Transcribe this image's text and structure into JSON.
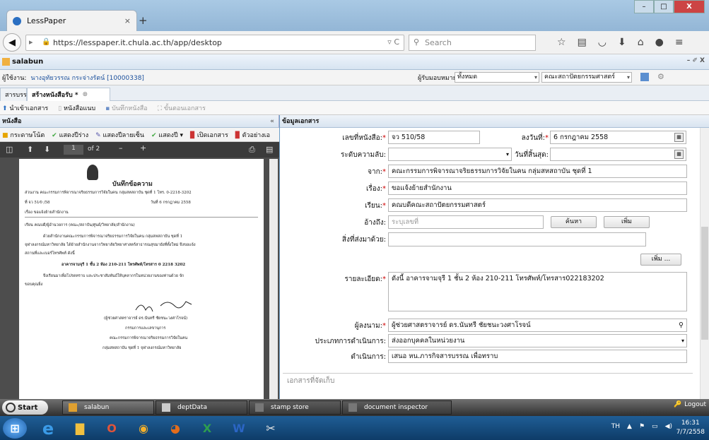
{
  "browser": {
    "tab_title": "LessPaper",
    "url": "https://lesspaper.it.chula.ac.th/app/desktop",
    "search_placeholder": "Search",
    "win_min": "–",
    "win_max": "□",
    "win_close": "X"
  },
  "app": {
    "title": "salabun",
    "window_controls": "– ✐ X"
  },
  "userbar": {
    "user_label": "ผู้ใช้งาน:",
    "user_value": "นางอุทัยวรรณ กระจ่างรัตน์ [10000338]",
    "assignee_label": "ผู้รับมอบหมาย:",
    "assignee_value": "ทั้งหมด",
    "dept_value": "คณะสถาปัตยกรรมศาสตร์"
  },
  "doc_tabs": [
    {
      "label": "สารบรรณ"
    },
    {
      "label": "สร้างหนังสือรับ *"
    }
  ],
  "toolbar": {
    "import": "นำเข้าเอกสาร",
    "letter": "หนังสือแนบ",
    "save": "บันทึกหนังสือ",
    "steps": "ขั้นตอนเอกสาร"
  },
  "left": {
    "title": "หนังสือ",
    "collapse": "«",
    "pdf_tools": [
      "กระดาษโน้ต",
      "แสดงปีร่าง",
      "แสดงปีลายเซ็น",
      "แสดงปี ▾",
      "เปิดเอกสาร",
      "ตัวอย่างเอ"
    ],
    "page_num": "1",
    "page_of": "of 2"
  },
  "pdf_page": {
    "title": "บันทึกข้อความ",
    "line1": "ส่วนงาน  คณะกรรมการพิจารณาจริยธรรมการวิจัยในคน กลุ่มสหสถาบัน ชุดที่ 1 โทร. 0-2218-3202",
    "line2": "ที่  จว 51⁄0 /58",
    "line2b": "วันที่  6  กรกฎาคม 2558",
    "line3": "เรื่อง  ขอแจ้งย้ายสำนักงาน",
    "line4": "เรียน  คณบดี/ผู้อำนวยการ (คณะ/สถาบัน/ศูนย์/วิทยาลัย/สำนักงาน)",
    "line5": "ด้วยสำนักงานคณะกรรมการพิจารณาจริยธรรมการวิจัยในคน กลุ่มสหสถาบัน ชุดที่ 1",
    "line6": "จุฬาลงกรณ์มหาวิทยาลัย ได้ย้ายสำนักงานจากวิทยาลัยวิทยาศาสตร์สาธารณสุขมายังที่ตั้งใหม่ จึงขอแจ้ง",
    "line7": "สถานที่และเบอร์โทรศัพท์ ดังนี้",
    "line8": "อาคารจามจุรี 1 ชั้น 2 ห้อง 210-211 โทรศัพท์/โทรสาร 0 2218 3202",
    "line9": "จึงเรียนมาเพื่อโปรดทราบ และประชาสัมพันธ์ให้บุคลากรในหน่วยงานของท่านด้วย จัก",
    "line10": "ขอบคุณยิ่ง",
    "sig1": "(ผู้ช่วยศาสตราจารย์ ดร.นันทรี ชัยชนะวงศาโรจน์)",
    "sig2": "กรรมการและเลขานุการ",
    "sig3": "คณะกรรมการพิจารณาจริยธรรมการวิจัยในคน",
    "sig4": "กลุ่มสหสถาบัน ชุดที่ 1 จุฬาลงกรณ์มหาวิทยาลัย"
  },
  "right": {
    "title": "ข้อมูลเอกสาร",
    "fields": {
      "doc_no_label": "เลขที่หนังสือ:",
      "doc_no": "จว 510/58",
      "date_label": "ลงวันที่:",
      "date": "6 กรกฎาคม 2558",
      "secret_label": "ระดับความลับ:",
      "secret": "",
      "due_label": "วันที่สิ้นสุด:",
      "due": "",
      "from_label": "จาก:",
      "from": "คณะกรรมการพิจารณาจริยธรรมการวิจัยในคน กลุ่มสหสถาบัน ชุดที่ 1",
      "subject_label": "เรื่อง:",
      "subject": "ขอแจ้งย้ายสำนักงาน",
      "to_label": "เรียน:",
      "to": "คณบดีคณะสถาปัตยกรรมศาสตร์",
      "ref_label": "อ้างถึง:",
      "ref_placeholder": "ระบุเลขที่",
      "find_btn": "ค้นหา",
      "add_btn": "เพิ่ม",
      "attach_label": "สิ่งที่ส่งมาด้วย:",
      "attach_add": "เพิ่ม ...",
      "detail_label": "รายละเอียด:",
      "detail": "ดังนี้ อาคารจามจุรี 1 ชั้น 2 ห้อง 210-211 โทรศัพท์/โทรสาร022183202",
      "signer_label": "ผู้ลงนาม:",
      "signer": "ผู้ช่วยศาสตราจารย์ ดร.นันทรี ชัยชนะวงศาโรจน์",
      "type_label": "ประเภทการดำเนินการ:",
      "type": "ส่งออกบุคคลในหน่วยงาน",
      "action_label": "ดำเนินการ:",
      "action": "เสนอ หน.ภารกิจสารบรรณ เพื่อทราบ",
      "section_label": "เอกสารที่จัดเก็บ"
    }
  },
  "taskbar": {
    "start": "Start",
    "items": [
      "salabun",
      "deptData",
      "stamp store",
      "document inspector"
    ],
    "logout": "Logout"
  },
  "winbar": {
    "lang": "TH",
    "time": "16:31",
    "date": "7/7/2558"
  }
}
